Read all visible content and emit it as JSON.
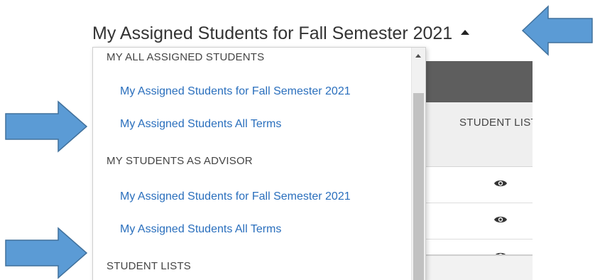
{
  "title": {
    "label": "My Assigned Students for Fall Semester 2021"
  },
  "dropdown": {
    "groups": [
      {
        "header": "MY ALL ASSIGNED STUDENTS",
        "items": [
          "My Assigned Students for Fall Semester 2021",
          "My Assigned Students All Terms"
        ]
      },
      {
        "header": "MY STUDENTS AS ADVISOR",
        "items": [
          "My Assigned Students for Fall Semester 2021",
          "My Assigned Students All Terms"
        ]
      },
      {
        "header": "STUDENT LISTS",
        "items": []
      }
    ]
  },
  "table": {
    "column_header": "STUDENT LISTS",
    "row_icon": "eye-icon"
  },
  "annotations": {
    "arrow_color": "#5b9bd5",
    "arrow_border": "#41719c"
  },
  "colors": {
    "link": "#2a6fbd",
    "header_dark": "#5e5e5e",
    "text": "#333333"
  }
}
